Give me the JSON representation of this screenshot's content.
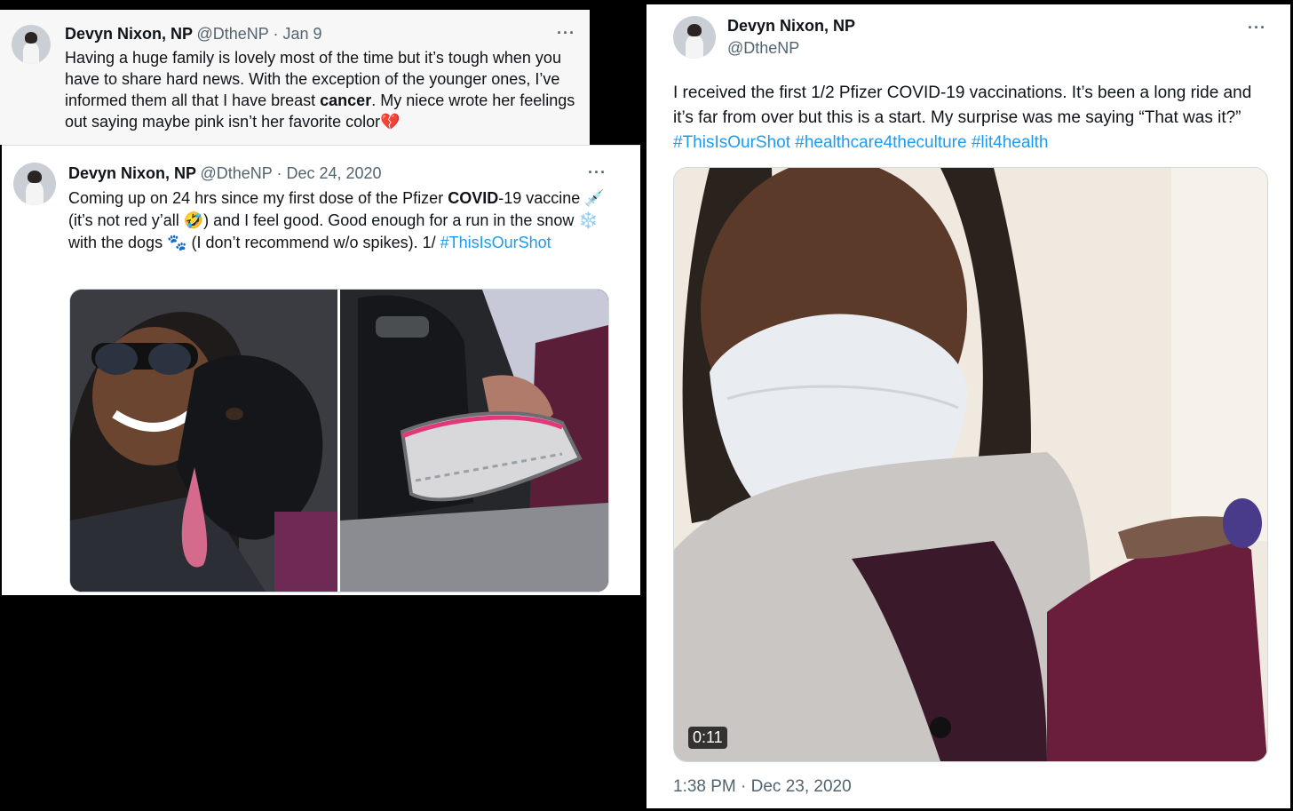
{
  "tweet1": {
    "name": "Devyn Nixon, NP",
    "meta": "@DtheNP · Jan 9",
    "more": "···",
    "text_a": "Having a huge family is lovely most of the time but it’s tough when you have to share hard news. With the exception of the younger ones, I’ve informed them all that I have breast ",
    "text_bold": "cancer",
    "text_b": ". My niece wrote her feelings out saying maybe pink isn’t her favorite color",
    "emoji": "💔"
  },
  "tweet2": {
    "name": "Devyn Nixon, NP",
    "meta": "@DtheNP · Dec 24, 2020",
    "more": "···",
    "text_a": "Coming up on 24 hrs since my first dose of the Pfizer ",
    "text_bold": "COVID",
    "text_b": "-19 vaccine 💉 (it’s not red y’all 🤣) and I feel good. Good enough for a run in the snow ❄️ with the dogs 🐾 (I don’t recommend w/o spikes). 1/ ",
    "hashtag": "#ThisIsOurShot"
  },
  "tweet3": {
    "name": "Devyn Nixon, NP",
    "handle": "@DtheNP",
    "more": "···",
    "text": "I received the first 1/2 Pfizer COVID-19 vaccinations.  It’s been a long ride and it’s far from over but this is a start. My surprise was me saying “That was it?” ",
    "hashtags": "#ThisIsOurShot #healthcare4theculture #lit4health",
    "video_duration": "0:11",
    "timestamp": "1:38 PM · Dec 23, 2020"
  },
  "colors": {
    "link": "#1d9bf0",
    "secondary_text": "#536471",
    "primary_text": "#0f1419",
    "canvas": "#000000"
  }
}
